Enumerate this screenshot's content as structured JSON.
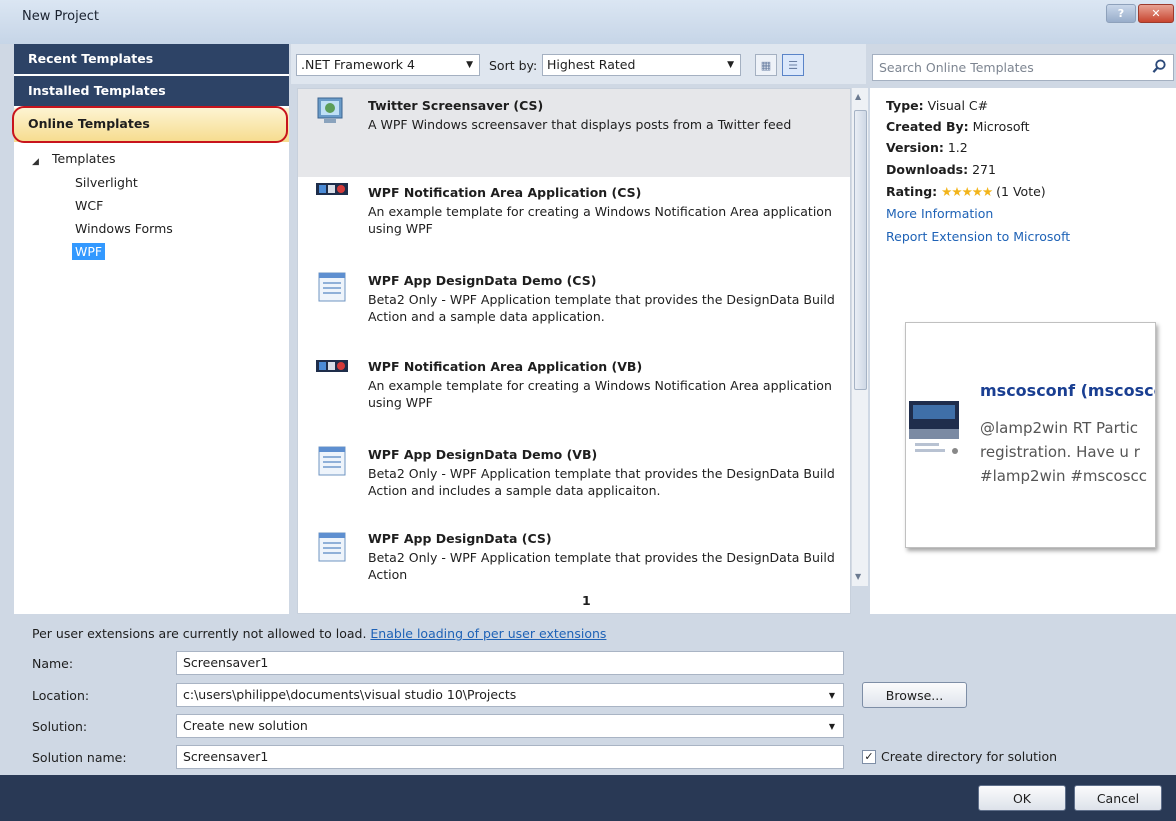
{
  "window": {
    "title": "New Project",
    "help_label": "?",
    "close_label": "✕"
  },
  "nav": {
    "recent": "Recent Templates",
    "installed": "Installed Templates",
    "online": "Online Templates",
    "tree_root": "Templates",
    "tree_items": [
      "Silverlight",
      "WCF",
      "Windows Forms",
      "WPF"
    ],
    "selected": "WPF"
  },
  "toolbar": {
    "framework": ".NET Framework 4",
    "sort_label": "Sort by:",
    "sort_value": "Highest Rated"
  },
  "search": {
    "placeholder": "Search Online Templates"
  },
  "templates": [
    {
      "title": "Twitter Screensaver (CS)",
      "desc": "A WPF Windows screensaver that displays posts from a Twitter feed",
      "icon": "twitter-screensaver-icon"
    },
    {
      "title": "WPF Notification Area Application (CS)",
      "desc": "An example template for creating a Windows Notification Area application using WPF",
      "icon": "notification-area-icon"
    },
    {
      "title": "WPF App DesignData Demo (CS)",
      "desc": "Beta2 Only - WPF Application template that provides the DesignData Build Action and a sample data application.",
      "icon": "document-template-icon"
    },
    {
      "title": "WPF Notification Area Application (VB)",
      "desc": "An example template for creating a Windows Notification Area application using WPF",
      "icon": "notification-area-icon"
    },
    {
      "title": "WPF App DesignData Demo (VB)",
      "desc": "Beta2 Only - WPF Application template that provides the DesignData Build Action and includes a sample data applicaiton.",
      "icon": "document-template-icon"
    },
    {
      "title": "WPF App DesignData (CS)",
      "desc": "Beta2 Only - WPF Application template that provides the DesignData Build Action",
      "icon": "document-template-icon"
    }
  ],
  "pager": "1",
  "details": {
    "type_label": "Type:",
    "type_value": "Visual C#",
    "created_label": "Created By:",
    "created_value": "Microsoft",
    "version_label": "Version:",
    "version_value": "1.2",
    "downloads_label": "Downloads:",
    "downloads_value": "271",
    "rating_label": "Rating:",
    "rating_stars": "★★★★★",
    "rating_votes": "(1 Vote)",
    "more_info": "More Information",
    "report": "Report Extension to Microsoft"
  },
  "preview": {
    "title": "mscosconf (mscoscc",
    "lines": [
      "@lamp2win RT Partic",
      "registration. Have u r",
      "#lamp2win #mscoscc"
    ]
  },
  "form": {
    "notice": "Per user extensions are currently not allowed to load.",
    "notice_link": "Enable loading of per user extensions",
    "name_label": "Name:",
    "name_value": "Screensaver1",
    "location_label": "Location:",
    "location_value": "c:\\users\\philippe\\documents\\visual studio 10\\Projects",
    "solution_label": "Solution:",
    "solution_value": "Create new solution",
    "solution_name_label": "Solution name:",
    "solution_name_value": "Screensaver1",
    "browse_label": "Browse...",
    "create_dir_label": "Create directory for solution",
    "create_dir_checked": true
  },
  "buttons": {
    "ok": "OK",
    "cancel": "Cancel"
  },
  "colors": {
    "nav_header": "#2d4366",
    "footer": "#293955",
    "highlight": "#c8141c",
    "link": "#1e62b6"
  }
}
